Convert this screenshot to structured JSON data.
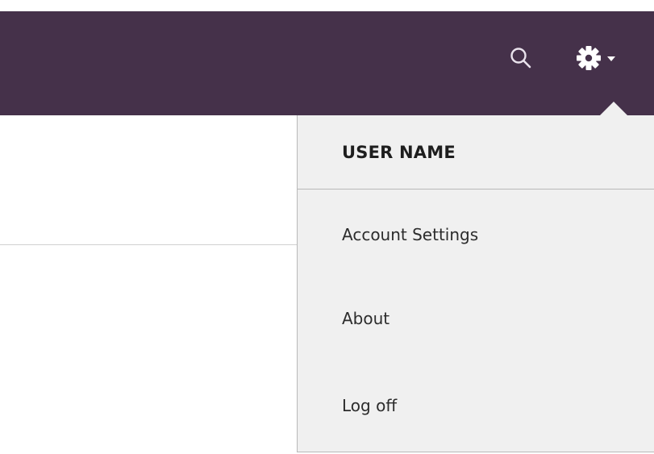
{
  "header": {
    "background_color": "#45314a",
    "icons": [
      "search-icon",
      "gear-icon",
      "caret-down-icon"
    ]
  },
  "user_menu": {
    "user_name": "USER NAME",
    "items": [
      {
        "label": "Account Settings"
      },
      {
        "label": "About"
      },
      {
        "label": "Log off"
      }
    ],
    "background_color": "#f0f0f0"
  }
}
